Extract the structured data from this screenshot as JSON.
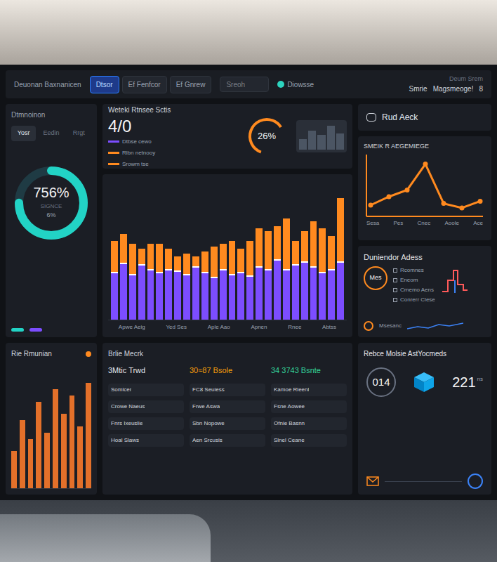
{
  "header": {
    "title": "Deuonan Baxnanicen",
    "tabs": [
      {
        "label": "Dtsor",
        "selected": true
      },
      {
        "label": "Ef Fenfcor",
        "selected": false
      },
      {
        "label": "Ef Gnrew",
        "selected": false
      }
    ],
    "search": {
      "placeholder": "Sreoh"
    },
    "status": {
      "label": "Diowsse",
      "color": "#2dd4bf"
    },
    "user": [
      "Smrie",
      "Magsmeoge!",
      "8"
    ],
    "top_right": "Deum Srem"
  },
  "gauge_panel": {
    "title": "Dtmnoinon",
    "tabs": [
      {
        "label": "Yosr",
        "selected": true
      },
      {
        "label": "Eedin",
        "selected": false
      },
      {
        "label": "Rrgt",
        "selected": false
      }
    ],
    "value": "756%",
    "caption": "SIGNCE",
    "sub": "6%",
    "level": 0.75
  },
  "stats_panel": {
    "title": "Weteki Rtnsee Sctis",
    "value": "4/0",
    "ring_value": "26%",
    "ring_level": 0.6,
    "legend": [
      {
        "label": "Dtbse cewo",
        "color": "#7c4dff"
      },
      {
        "label": "Rlbn netnooy",
        "color": "#ff8a1f"
      },
      {
        "label": "Srowm tse",
        "color": "#ff8a1f"
      }
    ]
  },
  "bar_chart": {
    "labels": [
      "Apwe Aeig",
      "Yed Ses",
      "Aple Aao",
      "Apnen",
      "Rnee",
      "Abtss"
    ],
    "series": [
      {
        "name": "base",
        "color": "#7c4dff",
        "values": [
          38,
          45,
          36,
          44,
          40,
          38,
          40,
          39,
          36,
          42,
          38,
          34,
          40,
          36,
          38,
          35,
          42,
          40,
          48,
          40,
          44,
          46,
          42,
          38,
          40,
          46
        ]
      },
      {
        "name": "peak",
        "color": "#ff8a1f",
        "values": [
          62,
          68,
          60,
          56,
          60,
          60,
          56,
          50,
          52,
          50,
          54,
          58,
          60,
          62,
          56,
          62,
          72,
          70,
          74,
          80,
          62,
          70,
          78,
          72,
          66,
          96
        ]
      }
    ]
  },
  "alert_card": {
    "title": "Rud Aeck"
  },
  "line_chart": {
    "title": "SMEIK R AEGEMIEGE",
    "labels": [
      "Sesa",
      "Pes",
      "Cnec",
      "Aoole",
      "Ace"
    ],
    "values": [
      15,
      30,
      42,
      88,
      18,
      10,
      22
    ]
  },
  "details_panel": {
    "title": "Duniendor Adess",
    "badge": "Mes",
    "items": [
      "Rcomnes",
      "Eneom",
      "Cmemo Aens",
      "Conrerr Clese"
    ],
    "footer": "Msesanc"
  },
  "trend_panel": {
    "title": "Rie Rmunian",
    "values": [
      30,
      55,
      40,
      70,
      45,
      80,
      60,
      75,
      50,
      85
    ]
  },
  "list_panel": {
    "title": "Brlie Mecrk",
    "columns": [
      {
        "title": "3Mtic Trwd",
        "color": "#e5e7eb",
        "rows": [
          "Somlcer",
          "Crowe Naeus",
          "Fnrs Ixeuslie",
          "Hoal Slaws"
        ]
      },
      {
        "title": "30≈87 Bsole",
        "color": "#f59e0b",
        "rows": [
          "FC8 Seuiess",
          "Frwe Aswa",
          "Sbn Nopowe",
          "Aen Srcusis"
        ]
      },
      {
        "title": "34 3743 Bsnte",
        "color": "#34d399",
        "rows": [
          "Kamoe Rleenl",
          "Fsne Aowee",
          "Ofnie Basnn",
          "Slnel Ceane"
        ]
      }
    ]
  },
  "metrics_panel": {
    "title": "Rebce Molsie AstYocmeds",
    "metrics": [
      {
        "kind": "ring",
        "value": "014"
      },
      {
        "kind": "icon"
      },
      {
        "kind": "number",
        "value": "221",
        "unit": "ns"
      }
    ]
  }
}
